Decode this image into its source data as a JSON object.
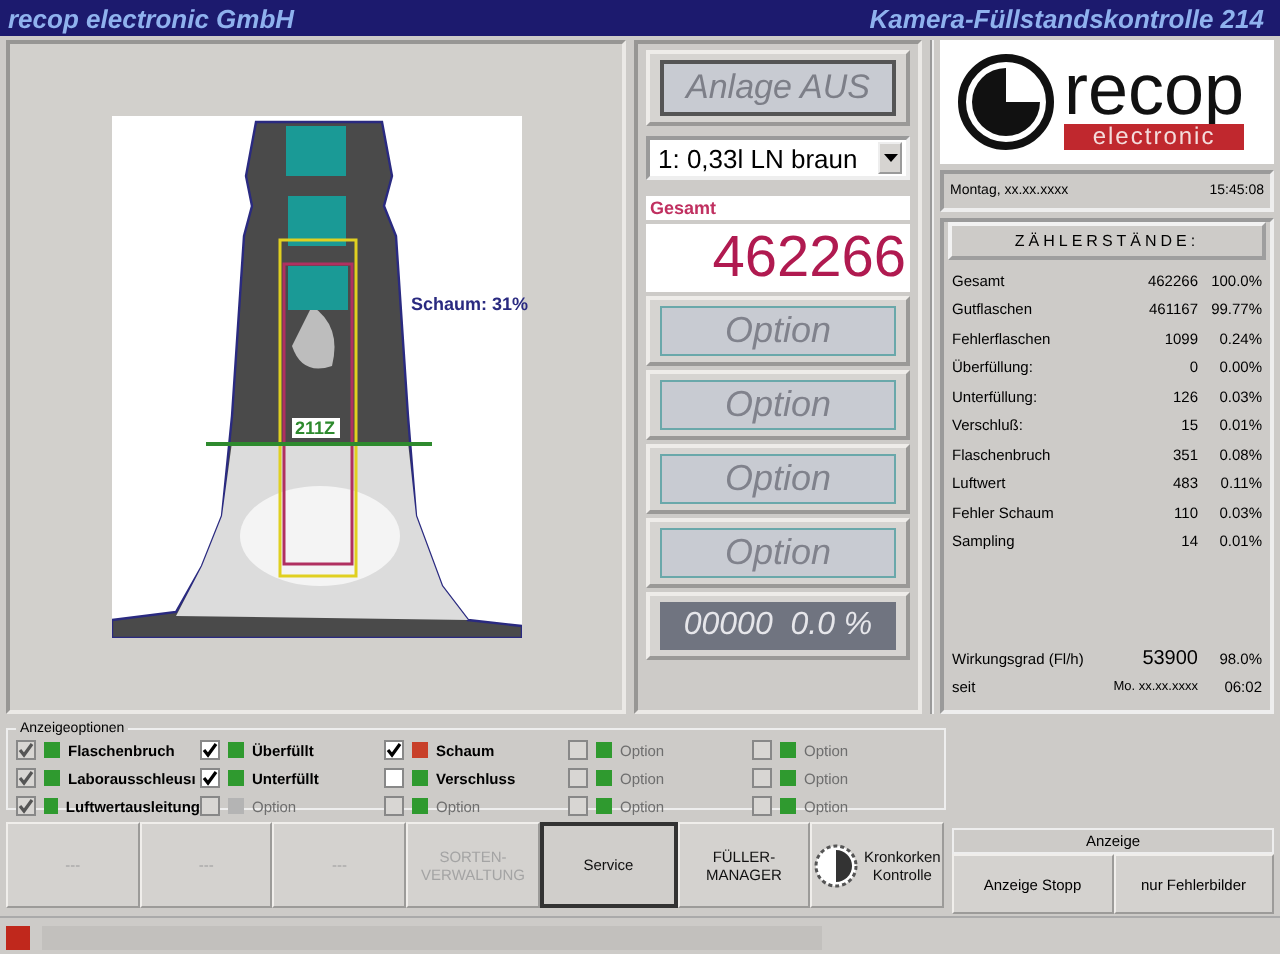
{
  "window": {
    "title_left": "recop electronic GmbH",
    "title_right": "Kamera-Füllstandskontrolle 214"
  },
  "camera": {
    "overlay_value": "211Z",
    "foam_reading": "Schaum: 31%"
  },
  "controls": {
    "plant_button": "Anlage AUS",
    "product_select": "1: 0,33l LN braun",
    "total_label": "Gesamt",
    "total_value": "462266",
    "option_buttons": [
      "Option",
      "Option",
      "Option",
      "Option"
    ],
    "counter_display": "00000  0.0 %"
  },
  "logo": {
    "name": "recop",
    "subtitle": "electronic"
  },
  "info": {
    "date": "Montag, xx.xx.xxxx",
    "time": "15:45:08"
  },
  "counters": {
    "title": "ZÄHLERSTÄNDE:",
    "rows": [
      {
        "label": "Gesamt",
        "count": "462266",
        "percent": "100.0%"
      },
      {
        "label": "Gutflaschen",
        "count": "461167",
        "percent": "99.77%"
      },
      {
        "label": "Fehlerflaschen",
        "count": "1099",
        "percent": "0.24%"
      },
      {
        "label": "Überfüllung:",
        "count": "0",
        "percent": "0.00%"
      },
      {
        "label": "Unterfüllung:",
        "count": "126",
        "percent": "0.03%"
      },
      {
        "label": "Verschluß:",
        "count": "15",
        "percent": "0.01%"
      },
      {
        "label": "Flaschenbruch",
        "count": "351",
        "percent": "0.08%"
      },
      {
        "label": "Luftwert",
        "count": "483",
        "percent": "0.11%"
      },
      {
        "label": "Fehler Schaum",
        "count": "110",
        "percent": "0.03%"
      },
      {
        "label": "Sampling",
        "count": "14",
        "percent": "0.01%"
      }
    ]
  },
  "efficiency": {
    "label": "Wirkungsgrad (Fl/h)",
    "value": "53900",
    "percent": "98.0%",
    "since_label": "seit",
    "since_date": "Mo. xx.xx.xxxx",
    "since_time": "06:02"
  },
  "display_options": {
    "title": "Anzeigeoptionen",
    "columns": [
      [
        {
          "label": "Flaschenbruch",
          "checked": true,
          "disabled": true,
          "color": "#2f9a2f"
        },
        {
          "label": "Laborausschleusı",
          "checked": true,
          "disabled": true,
          "color": "#2f9a2f"
        },
        {
          "label": "Luftwertausleitung",
          "checked": true,
          "disabled": true,
          "color": "#2f9a2f"
        }
      ],
      [
        {
          "label": "Überfüllt",
          "checked": true,
          "disabled": false,
          "color": "#2f9a2f"
        },
        {
          "label": "Unterfüllt",
          "checked": true,
          "disabled": false,
          "color": "#2f9a2f"
        },
        {
          "label": "Option",
          "checked": false,
          "disabled": true,
          "color": "#b4b4b4"
        }
      ],
      [
        {
          "label": "Schaum",
          "checked": true,
          "disabled": false,
          "color": "#c8402a"
        },
        {
          "label": "Verschluss",
          "checked": false,
          "disabled": false,
          "color": "#2f9a2f"
        },
        {
          "label": "Option",
          "checked": false,
          "disabled": true,
          "color": "#2f9a2f"
        }
      ],
      [
        {
          "label": "Option",
          "checked": false,
          "disabled": true,
          "color": "#2f9a2f"
        },
        {
          "label": "Option",
          "checked": false,
          "disabled": true,
          "color": "#2f9a2f"
        },
        {
          "label": "Option",
          "checked": false,
          "disabled": true,
          "color": "#2f9a2f"
        }
      ],
      [
        {
          "label": "Option",
          "checked": false,
          "disabled": true,
          "color": "#2f9a2f"
        },
        {
          "label": "Option",
          "checked": false,
          "disabled": true,
          "color": "#2f9a2f"
        },
        {
          "label": "Option",
          "checked": false,
          "disabled": true,
          "color": "#2f9a2f"
        }
      ]
    ]
  },
  "nav_buttons": [
    {
      "kind": "text",
      "lines": [
        "---"
      ],
      "disabled": true,
      "selected": false
    },
    {
      "kind": "text",
      "lines": [
        "---"
      ],
      "disabled": true,
      "selected": false
    },
    {
      "kind": "text",
      "lines": [
        "---"
      ],
      "disabled": true,
      "selected": false
    },
    {
      "kind": "text",
      "lines": [
        "SORTEN-",
        "VERWALTUNG"
      ],
      "disabled": true,
      "selected": false
    },
    {
      "kind": "text",
      "lines": [
        "Service"
      ],
      "disabled": false,
      "selected": true
    },
    {
      "kind": "text",
      "lines": [
        "FÜLLER-",
        "MANAGER"
      ],
      "disabled": false,
      "selected": false
    },
    {
      "kind": "dial",
      "lines": [
        "Kronkorken",
        "Kontrolle"
      ],
      "disabled": false,
      "selected": false
    }
  ],
  "display_panel": {
    "title": "Anzeige",
    "buttons": [
      "Anzeige Stopp",
      "nur Fehlerbilder"
    ]
  }
}
